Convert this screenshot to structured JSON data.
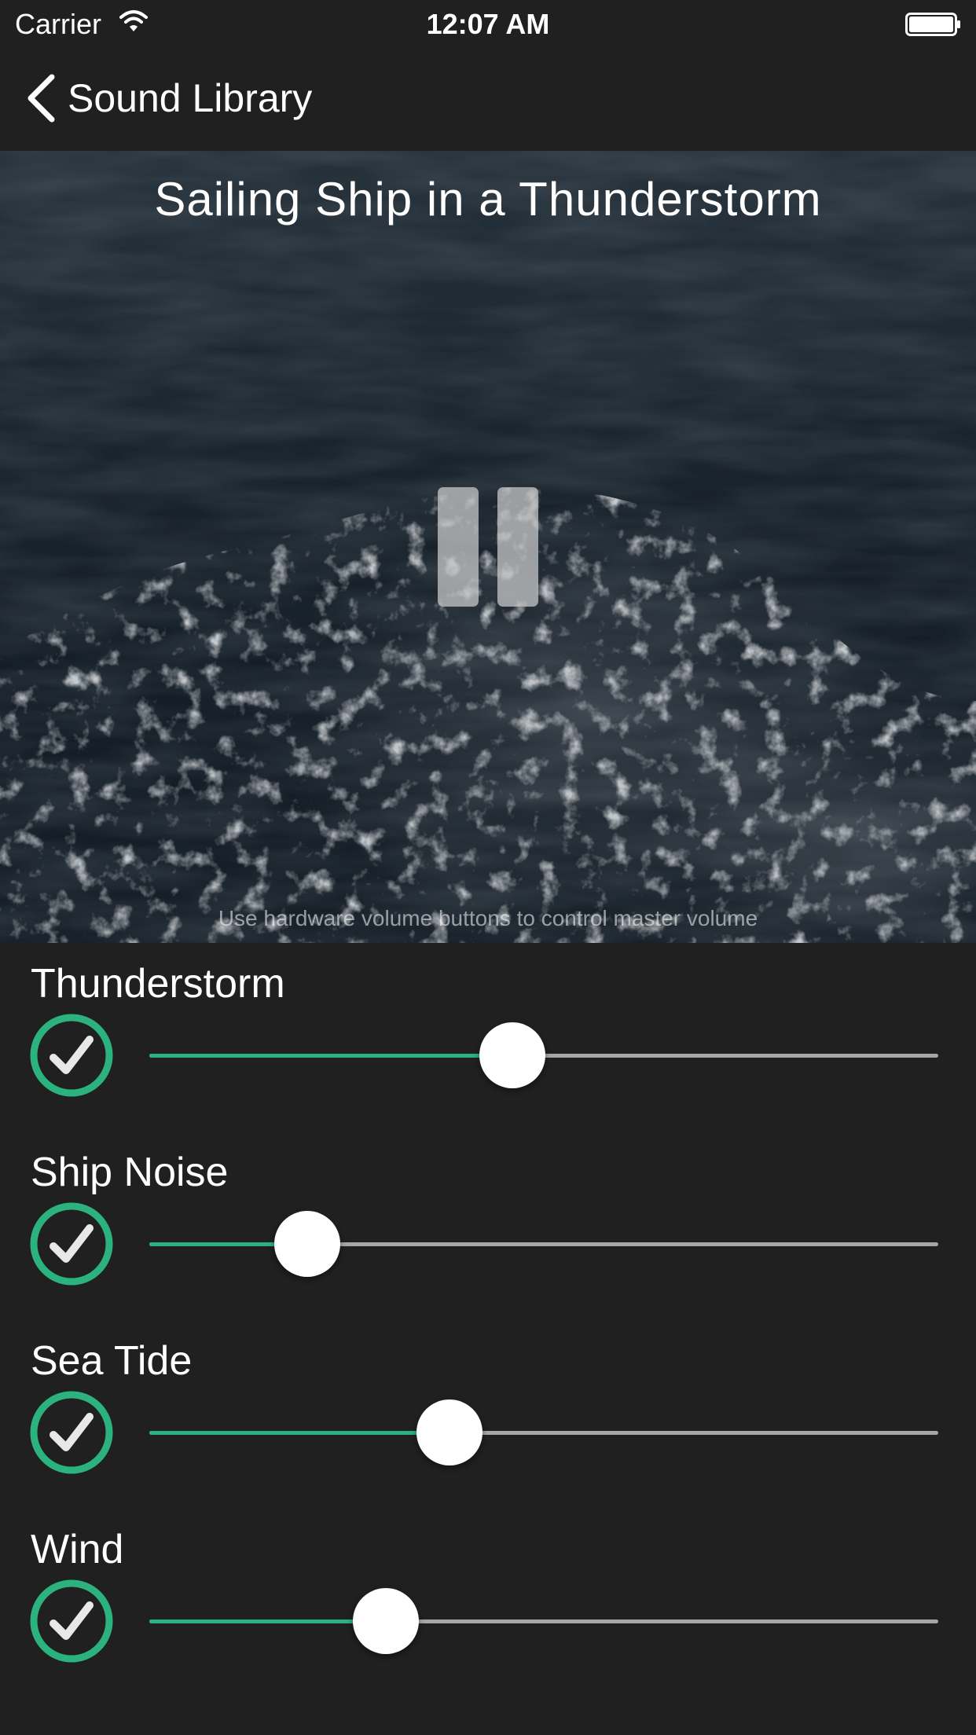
{
  "status_bar": {
    "carrier": "Carrier",
    "time": "12:07 AM"
  },
  "nav": {
    "back_label": "Sound Library"
  },
  "hero": {
    "title": "Sailing Ship in a Thunderstorm",
    "hint": "Use hardware volume buttons to control master volume",
    "playback_state": "playing",
    "control_icon": "pause-icon"
  },
  "mixer": {
    "tracks": [
      {
        "label": "Thunderstorm",
        "enabled": true,
        "level": 0.46
      },
      {
        "label": "Ship Noise",
        "enabled": true,
        "level": 0.2
      },
      {
        "label": "Sea Tide",
        "enabled": true,
        "level": 0.38
      },
      {
        "label": "Wind",
        "enabled": true,
        "level": 0.3
      }
    ]
  },
  "colors": {
    "background": "#202020",
    "accent": "#2bb27f",
    "track": "#a6a6a6",
    "thumb": "#ffffff"
  }
}
